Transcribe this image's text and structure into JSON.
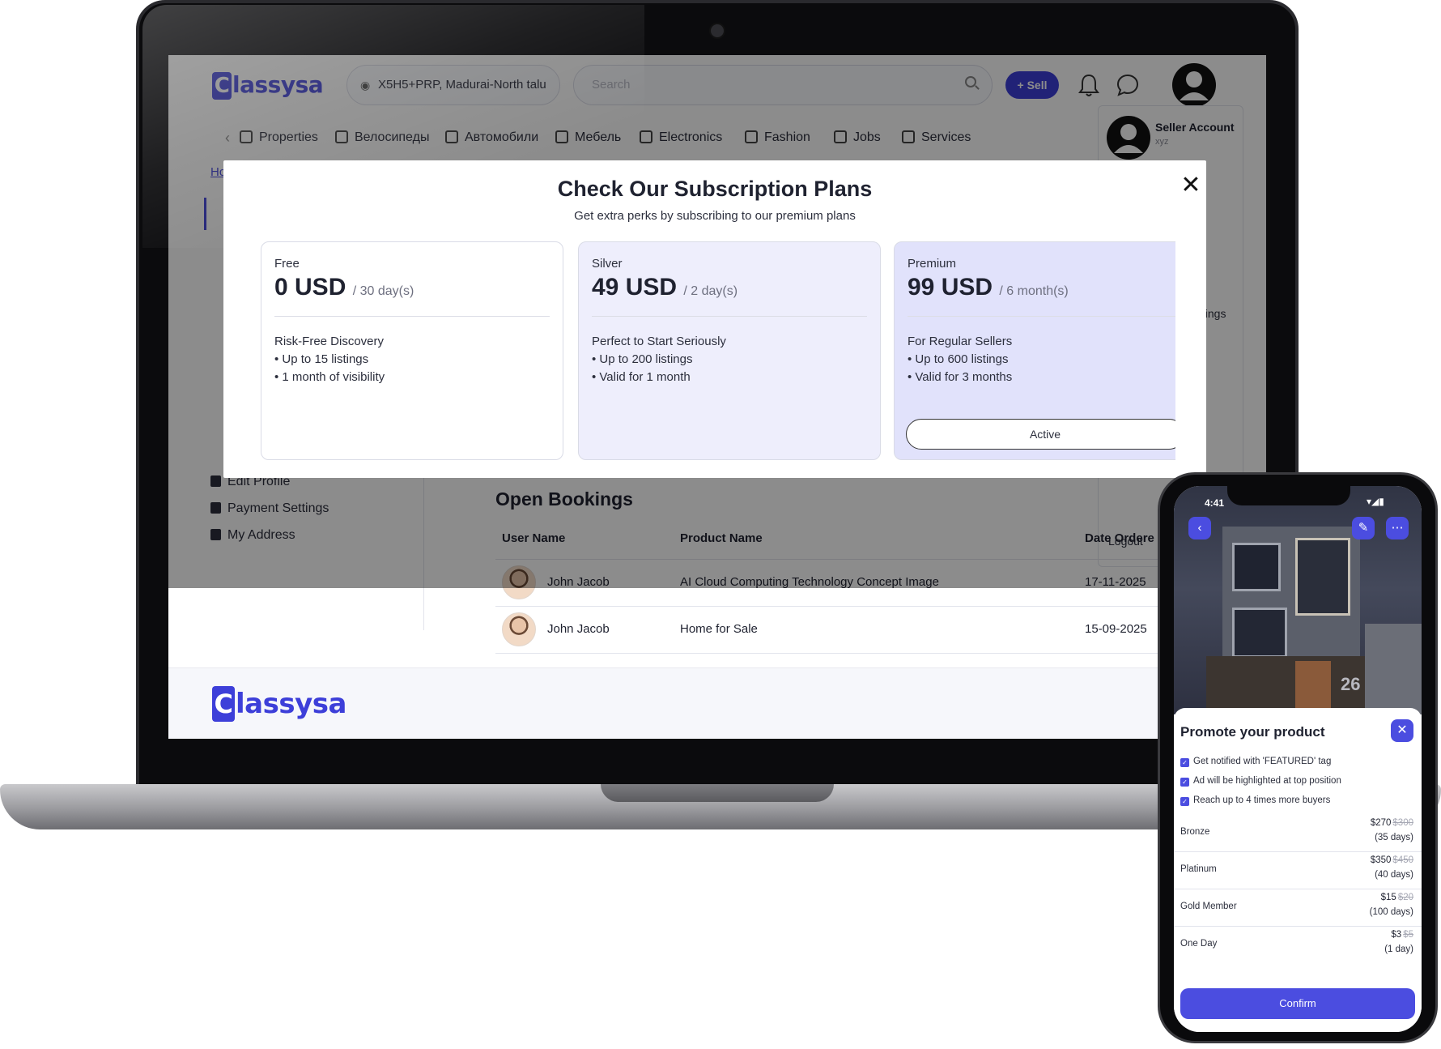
{
  "laptop": {
    "header": {
      "logo": "lassysa",
      "logo_mark": "C",
      "location": "X5H5+PRP, Madurai-North talu",
      "search_placeholder": "Search",
      "sell_label": "+ Sell"
    },
    "categories": [
      {
        "label": "Properties",
        "icon": "home-icon"
      },
      {
        "label": "Велосипеды",
        "icon": "bike-icon"
      },
      {
        "label": "Автомобили",
        "icon": "car-icon"
      },
      {
        "label": "Мебель",
        "icon": "furniture-icon"
      },
      {
        "label": "Electronics",
        "icon": "monitor-icon"
      },
      {
        "label": "Fashion",
        "icon": "bag-icon"
      },
      {
        "label": "Jobs",
        "icon": "user-icon"
      },
      {
        "label": "Services",
        "icon": "briefcase-icon"
      }
    ],
    "seller_popover": {
      "name": "Seller Account",
      "sub": "xyz",
      "settings_fragment": "ttings",
      "logout": "Logout"
    },
    "breadcrumb": "Hc",
    "sidebar": {
      "items": [
        "Edit Profile",
        "Payment Settings",
        "My Address"
      ]
    },
    "bookings": {
      "title": "Open Bookings",
      "columns": [
        "User Name",
        "Product Name",
        "Date Ordere"
      ],
      "rows": [
        {
          "user": "John Jacob",
          "product": "AI Cloud Computing Technology Concept Image",
          "date": "17-11-2025"
        },
        {
          "user": "John Jacob",
          "product": "Home for Sale",
          "date": "15-09-2025"
        }
      ]
    },
    "modal": {
      "title": "Check Our Subscription Plans",
      "subtitle": "Get extra perks by subscribing to our premium plans",
      "close": "✕",
      "plans": [
        {
          "name": "Free",
          "price": "0 USD",
          "period": "/ 30 day(s)",
          "headline": "Risk-Free Discovery",
          "features": [
            "• Up to 15 listings",
            "• 1 month of visibility"
          ],
          "bg": "#ffffff"
        },
        {
          "name": "Silver",
          "price": "49 USD",
          "period": "/ 2 day(s)",
          "headline": "Perfect to Start Seriously",
          "features": [
            "• Up to 200 listings",
            "• Valid for 1 month"
          ],
          "bg": "#eeeefc"
        },
        {
          "name": "Premium",
          "price": "99 USD",
          "period": "/ 6 month(s)",
          "headline": "For Regular Sellers",
          "features": [
            "• Up to 600 listings",
            "• Valid for 3 months"
          ],
          "bg": "#e1e2fb",
          "button": "Active"
        }
      ]
    }
  },
  "phone": {
    "status_time": "4:41",
    "plate": "26",
    "promo": {
      "title": "Promote your product",
      "perks": [
        "Get notified with 'FEATURED' tag",
        "Ad will be highlighted at top position",
        "Reach up to 4 times more buyers"
      ],
      "tiers": [
        {
          "name": "Bronze",
          "price": "$270",
          "old": "$300",
          "days": "(35 days)"
        },
        {
          "name": "Platinum",
          "price": "$350",
          "old": "$450",
          "days": "(40 days)"
        },
        {
          "name": "Gold Member",
          "price": "$15",
          "old": "$20",
          "days": "(100 days)"
        },
        {
          "name": "One Day",
          "price": "$3",
          "old": "$5",
          "days": "(1 day)"
        }
      ],
      "confirm": "Confirm"
    }
  },
  "colors": {
    "brand": "#3d3fd9",
    "phone_accent": "#4b4de0"
  }
}
